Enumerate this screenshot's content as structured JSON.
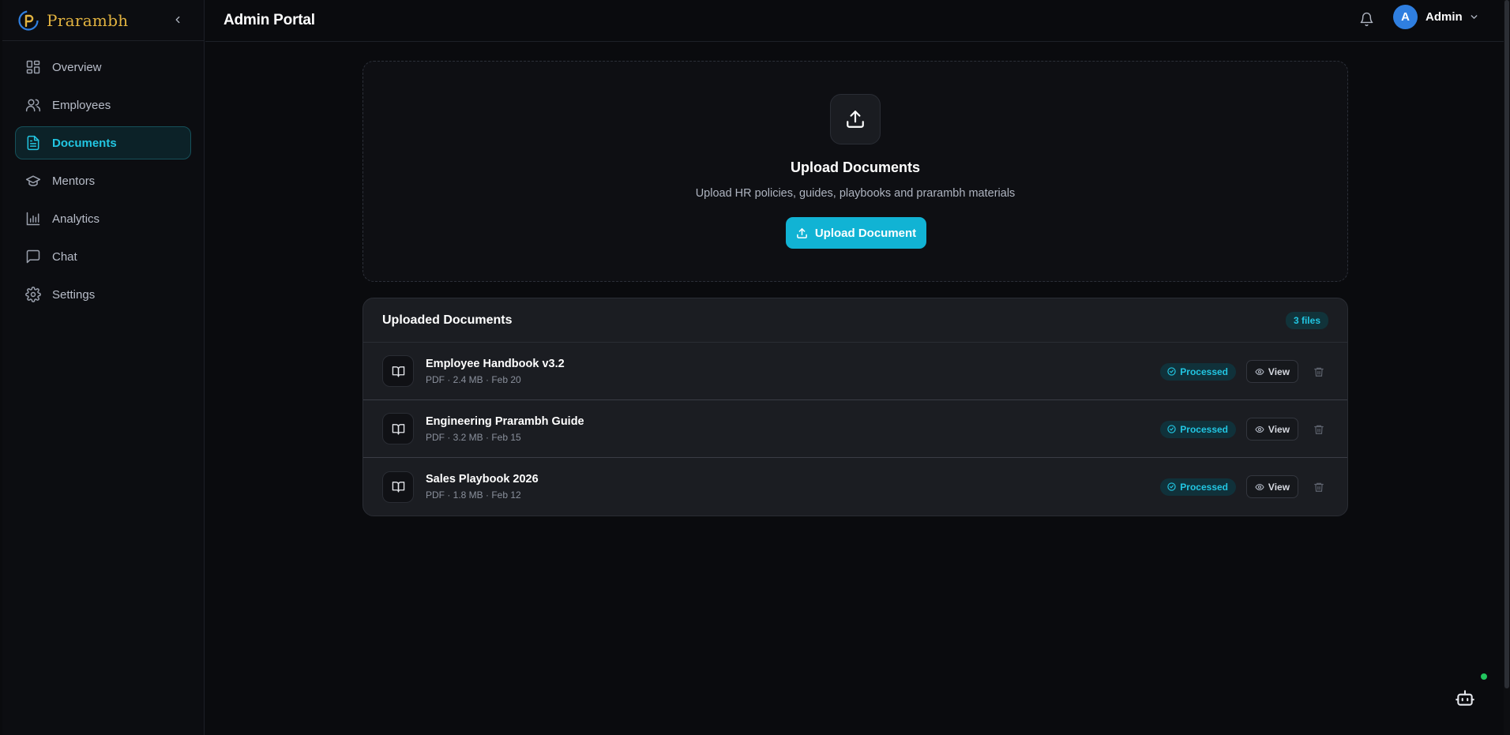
{
  "brand": {
    "name": "Prarambh"
  },
  "header": {
    "title": "Admin Portal",
    "user": {
      "initial": "A",
      "name": "Admin"
    }
  },
  "sidebar": {
    "items": [
      {
        "label": "Overview",
        "icon": "layout-grid-icon"
      },
      {
        "label": "Employees",
        "icon": "users-icon"
      },
      {
        "label": "Documents",
        "icon": "file-text-icon",
        "active": true
      },
      {
        "label": "Mentors",
        "icon": "graduation-cap-icon"
      },
      {
        "label": "Analytics",
        "icon": "bar-chart-icon"
      },
      {
        "label": "Chat",
        "icon": "message-square-icon"
      },
      {
        "label": "Settings",
        "icon": "gear-icon"
      }
    ]
  },
  "upload": {
    "title": "Upload Documents",
    "subtitle": "Upload HR policies, guides, playbooks and prarambh materials",
    "button_label": "Upload Document"
  },
  "documents": {
    "title": "Uploaded Documents",
    "count": "3 files",
    "rows": [
      {
        "name": "Employee Handbook v3.2",
        "meta": "PDF · 2.4 MB · Feb 20",
        "status": "Processed",
        "view_label": "View"
      },
      {
        "name": "Engineering Prarambh Guide",
        "meta": "PDF · 3.2 MB · Feb 15",
        "status": "Processed",
        "view_label": "View"
      },
      {
        "name": "Sales Playbook 2026",
        "meta": "PDF · 1.8 MB · Feb 12",
        "status": "Processed",
        "view_label": "View"
      }
    ]
  },
  "colors": {
    "accent": "#11b3d4",
    "brand_gold": "#e2b340",
    "online": "#22c55e"
  }
}
